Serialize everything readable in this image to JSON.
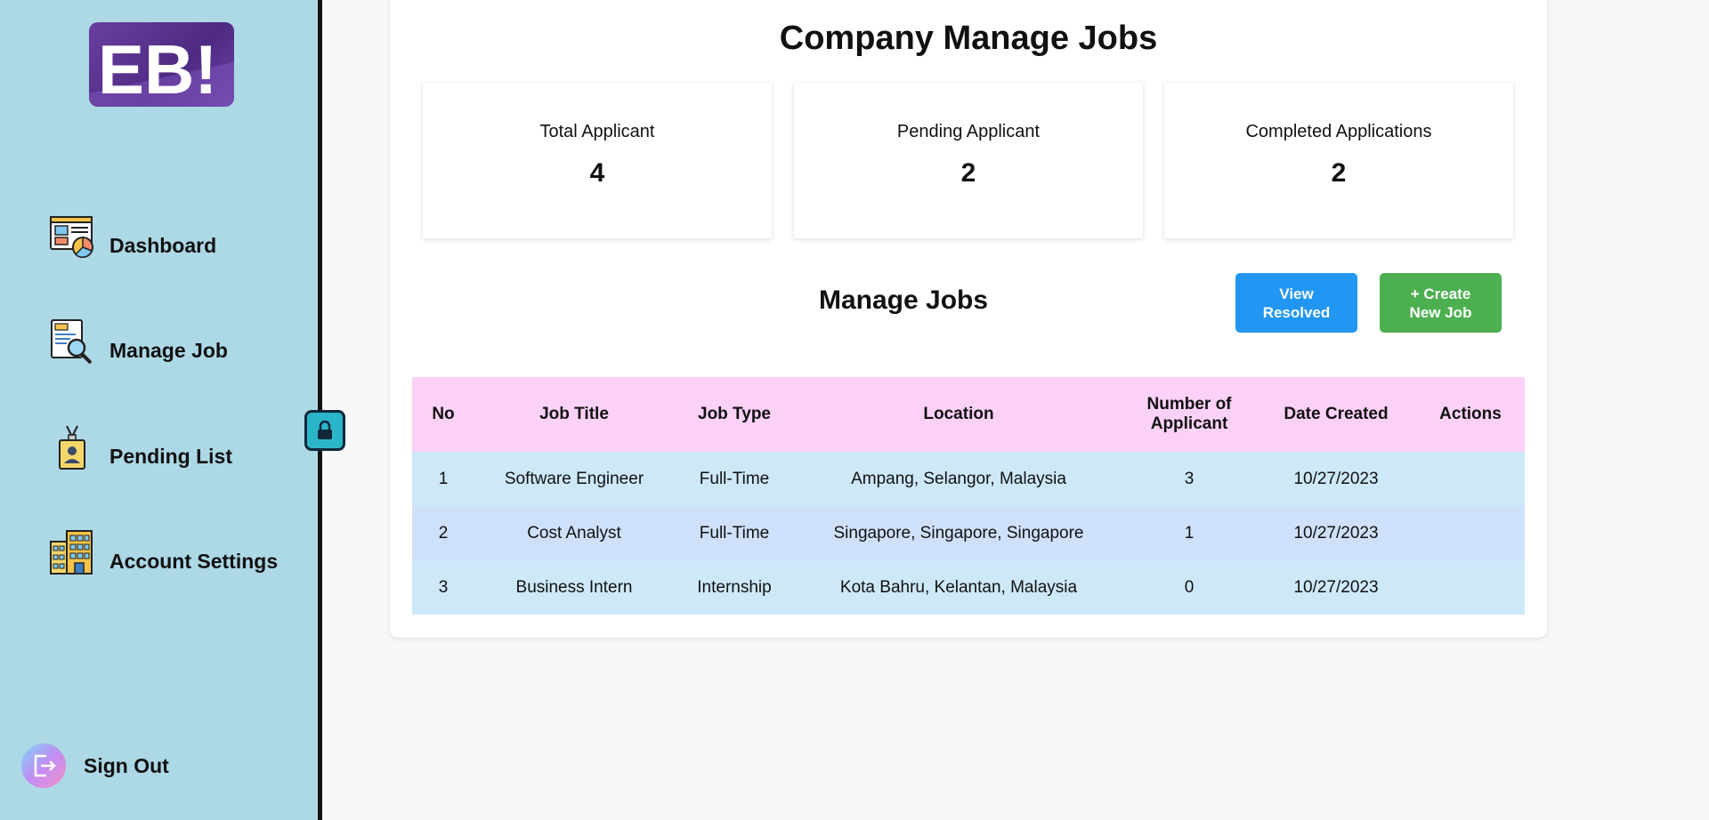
{
  "sidebar": {
    "logo_text": "EB!",
    "nav": [
      {
        "label": "Dashboard",
        "icon": "dashboard-icon"
      },
      {
        "label": "Manage Job",
        "icon": "job-search-icon"
      },
      {
        "label": "Pending List",
        "icon": "id-badge-icon"
      },
      {
        "label": "Account Settings",
        "icon": "building-icon"
      }
    ],
    "signout_label": "Sign Out"
  },
  "main": {
    "title": "Company Manage Jobs",
    "stats": [
      {
        "label": "Total Applicant",
        "value": "4"
      },
      {
        "label": "Pending Applicant",
        "value": "2"
      },
      {
        "label": "Completed Applications",
        "value": "2"
      }
    ],
    "section_title": "Manage Jobs",
    "buttons": {
      "view_resolved": "View\nResolved",
      "create_job": "+ Create\nNew Job"
    },
    "table": {
      "headers": [
        "No",
        "Job Title",
        "Job Type",
        "Location",
        "Number of Applicant",
        "Date Created",
        "Actions"
      ],
      "rows": [
        [
          "1",
          "Software Engineer",
          "Full-Time",
          "Ampang, Selangor, Malaysia",
          "3",
          "10/27/2023",
          ""
        ],
        [
          "2",
          "Cost Analyst",
          "Full-Time",
          "Singapore, Singapore, Singapore",
          "1",
          "10/27/2023",
          ""
        ],
        [
          "3",
          "Business Intern",
          "Internship",
          "Kota Bahru, Kelantan, Malaysia",
          "0",
          "10/27/2023",
          ""
        ]
      ]
    }
  },
  "colors": {
    "sidebar_bg": "#add8e6",
    "table_header_bg": "#fcd1f7",
    "row_odd": "#cde8f9",
    "row_even": "#cfe0fb",
    "view_resolved": "#2196f3",
    "create_job": "#4caf50"
  }
}
